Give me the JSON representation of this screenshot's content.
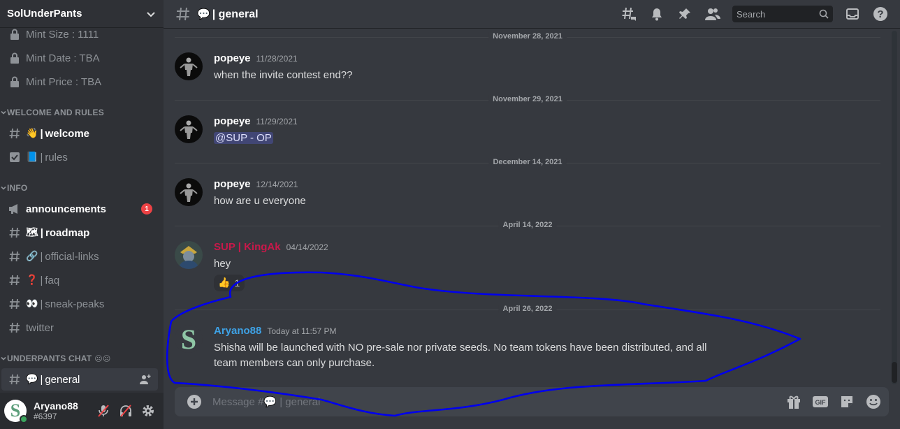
{
  "server": {
    "name": "SolUnderPants"
  },
  "sidebar": {
    "top_items": [
      {
        "label": "Mint Size : 1111",
        "icon": "lock-icon"
      },
      {
        "label": "Mint Date : TBA",
        "icon": "lock-icon"
      },
      {
        "label": "Mint Price : TBA",
        "icon": "lock-icon"
      }
    ],
    "categories": [
      {
        "label": "WELCOME AND RULES"
      },
      {
        "label": "INFO"
      },
      {
        "label": "UNDERPANTS CHAT",
        "emoji": "☹☹"
      }
    ],
    "welcome_channels": [
      {
        "emoji": "👋",
        "name": "welcome",
        "icon": "hash-icon"
      },
      {
        "emoji": "📘",
        "name": "rules",
        "icon": "checkbox-icon"
      }
    ],
    "info_channels": [
      {
        "emoji": "",
        "name": "announcements",
        "icon": "megaphone-icon",
        "badge": "1"
      },
      {
        "emoji": "🗺",
        "name": "roadmap",
        "icon": "hash-icon"
      },
      {
        "emoji": "🔗",
        "name": "official-links",
        "icon": "hash-icon"
      },
      {
        "emoji": "❓",
        "name": "faq",
        "icon": "hash-icon"
      },
      {
        "emoji": "👀",
        "name": "sneak-peaks",
        "icon": "hash-icon"
      },
      {
        "emoji": "",
        "name": "twitter",
        "icon": "hash-icon"
      }
    ],
    "chat_channels": [
      {
        "emoji": "💬",
        "name": "general",
        "icon": "hash-icon"
      }
    ],
    "separator": "|"
  },
  "user": {
    "name": "Aryano88",
    "tag": "#6397",
    "avatar_letter": "S"
  },
  "channel": {
    "emoji": "💬",
    "name": "general",
    "separator": "|"
  },
  "header": {
    "search_placeholder": "Search"
  },
  "messages": [
    {
      "date": "November 28, 2021",
      "author": "popeye",
      "timestamp": "11/28/2021",
      "text": "when the invite contest end??"
    },
    {
      "date": "November 29, 2021",
      "author": "popeye",
      "timestamp": "11/29/2021",
      "mention": "@SUP - OP"
    },
    {
      "date": "December 14, 2021",
      "author": "popeye",
      "timestamp": "12/14/2021",
      "text": "how are u everyone"
    },
    {
      "date": "April 14, 2022",
      "author": "SUP | KingAk",
      "timestamp": "04/14/2022",
      "text": "hey",
      "reaction": {
        "emoji": "👍",
        "count": "1"
      }
    },
    {
      "date": "April 26, 2022",
      "author": "Aryano88",
      "timestamp": "Today at 11:57 PM",
      "text": "Shisha will be launched with NO pre-sale nor private seeds. No team tokens have been distributed, and all team members can only purchase."
    }
  ],
  "composer": {
    "placeholder": "Message #💬 | general"
  },
  "colors": {
    "kingak_name": "#c9184a",
    "aryano_name": "#3ea2e6",
    "badge": "#ed4245",
    "annotation_stroke": "#0000ee"
  }
}
